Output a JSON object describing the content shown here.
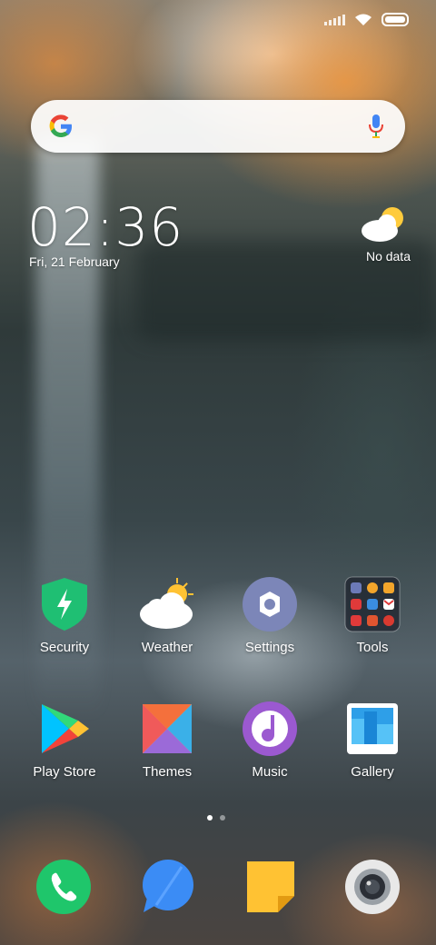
{
  "status_bar": {
    "icons": [
      "signal-icon",
      "wifi-icon",
      "battery-icon"
    ]
  },
  "search": {
    "logo": "google-g-icon",
    "mic": "microphone-icon"
  },
  "clock": {
    "time": "02:36",
    "date": "Fri, 21 February"
  },
  "weather_widget": {
    "icon": "cloud-sun-icon",
    "status": "No data"
  },
  "apps_row1": [
    {
      "label": "Security",
      "icon": "security-shield-icon",
      "color": "#1fbf73"
    },
    {
      "label": "Weather",
      "icon": "weather-icon",
      "color": "#ffffff"
    },
    {
      "label": "Settings",
      "icon": "settings-gear-icon",
      "color": "#7c86b8"
    },
    {
      "label": "Tools",
      "icon": "folder-tools-icon",
      "color": "#2a2f3a"
    }
  ],
  "apps_row2": [
    {
      "label": "Play Store",
      "icon": "play-store-icon",
      "color": "#00c3ff"
    },
    {
      "label": "Themes",
      "icon": "themes-icon",
      "color": "#f4703c"
    },
    {
      "label": "Music",
      "icon": "music-note-icon",
      "color": "#9b59d0"
    },
    {
      "label": "Gallery",
      "icon": "gallery-icon",
      "color": "#2e9fe8"
    }
  ],
  "page_indicator": {
    "pages": 2,
    "current": 1
  },
  "dock": [
    {
      "name": "phone",
      "icon": "phone-icon",
      "color": "#1fc66b"
    },
    {
      "name": "messaging",
      "icon": "message-icon",
      "color": "#3b8cf5"
    },
    {
      "name": "notes",
      "icon": "notes-icon",
      "color": "#ffc233"
    },
    {
      "name": "camera",
      "icon": "camera-icon",
      "color": "#e8e8e8"
    }
  ]
}
